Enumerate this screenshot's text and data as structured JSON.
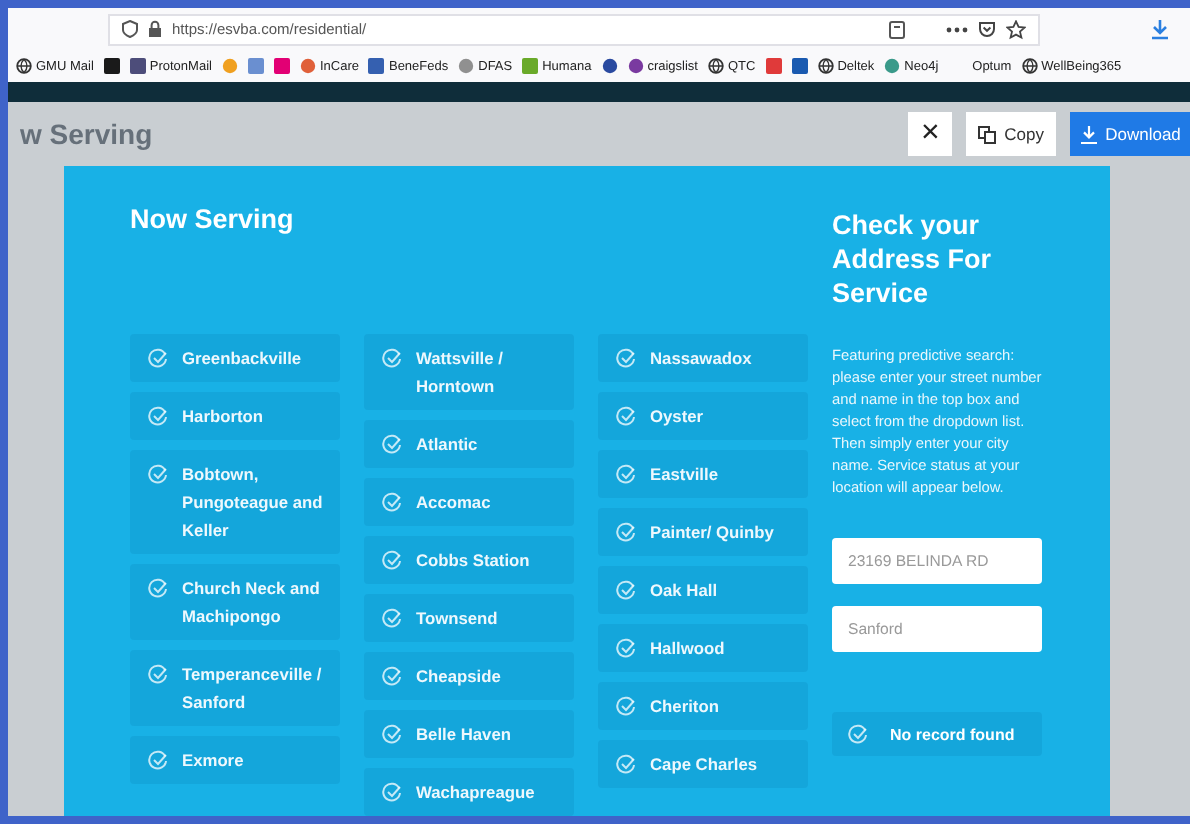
{
  "browser": {
    "url": "https://esvba.com/residential/",
    "bookmarks": [
      {
        "label": "GMU Mail",
        "kind": "globe"
      },
      {
        "kind": "tile",
        "color": "#1a1a1a"
      },
      {
        "label": "ProtonMail",
        "kind": "tile",
        "color": "#4d4d7a"
      },
      {
        "kind": "dot",
        "color": "#f0a020"
      },
      {
        "kind": "tile",
        "color": "#6a8fd0"
      },
      {
        "kind": "tile",
        "color": "#e20074"
      },
      {
        "label": "InCare",
        "kind": "dot",
        "color": "#e0603a"
      },
      {
        "label": "BeneFeds",
        "kind": "tile",
        "color": "#3560b0"
      },
      {
        "label": "DFAS",
        "kind": "dot",
        "color": "#909090"
      },
      {
        "label": "Humana",
        "kind": "tile",
        "color": "#6aaa2a"
      },
      {
        "kind": "dot",
        "color": "#2a4aa0"
      },
      {
        "label": "craigslist",
        "kind": "dot",
        "color": "#7a3aa0"
      },
      {
        "label": "QTC",
        "kind": "globe"
      },
      {
        "kind": "tile",
        "color": "#e03a3a"
      },
      {
        "kind": "tile",
        "color": "#1a5ab0"
      },
      {
        "label": "Deltek",
        "kind": "globe"
      },
      {
        "label": "Neo4j",
        "kind": "dot",
        "color": "#3a9a8a"
      },
      {
        "label": "Optum",
        "kind": "blank"
      },
      {
        "label": "WellBeing365",
        "kind": "globe"
      }
    ]
  },
  "viewer": {
    "background_heading": "w Serving",
    "buttons": [
      {
        "kind": "close",
        "label": "×"
      },
      {
        "kind": "copy",
        "label": "Copy"
      },
      {
        "kind": "download",
        "label": "Download"
      }
    ]
  },
  "now_serving": {
    "title": "Now Serving",
    "columns": [
      [
        "Greenbackville",
        "Harborton",
        "Bobtown, Pungoteague and Keller",
        "Church Neck and Machipongo",
        "Temperanceville / Sanford",
        "Exmore"
      ],
      [
        "Wattsville / Horntown",
        "Atlantic",
        "Accomac",
        "Cobbs Station",
        "Townsend",
        "Cheapside",
        "Belle Haven",
        "Wachapreague"
      ],
      [
        "Nassawadox",
        "Oyster",
        "Eastville",
        "Painter/ Quinby",
        "Oak Hall",
        "Hallwood",
        "Cheriton",
        "Cape Charles"
      ]
    ]
  },
  "address_check": {
    "title": "Check your Address For Service",
    "description": "Featuring predictive search: please enter your street number and name in the top box and select from the dropdown list. Then simply enter your city name. Service status at your location will appear below.",
    "fields": [
      {
        "value": "23169 BELINDA RD"
      },
      {
        "value": "Sanford"
      }
    ],
    "result": "No record found"
  }
}
